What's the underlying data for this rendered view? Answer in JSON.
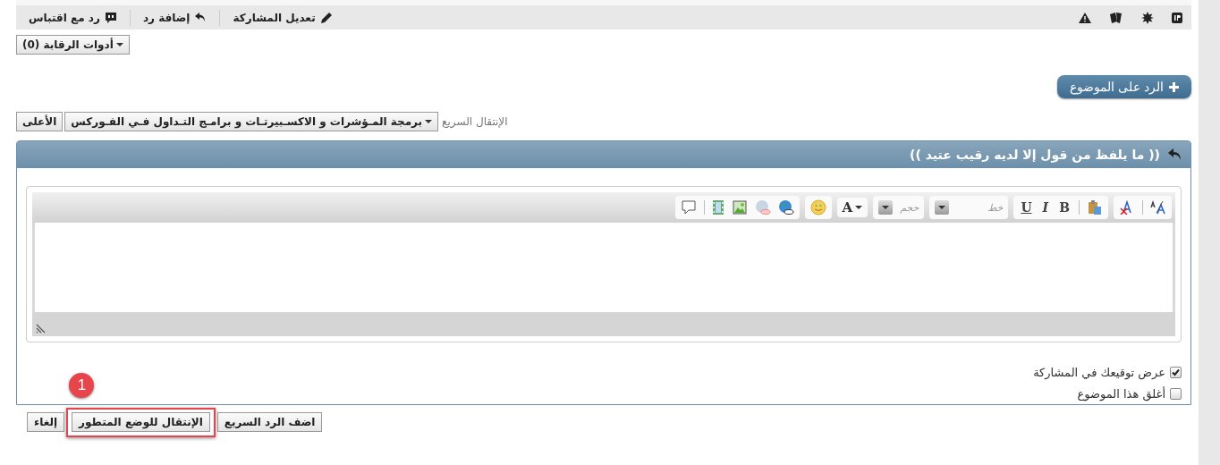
{
  "post_toolbar": {
    "links": [
      {
        "label": "تعديل المشاركة",
        "kind": "edit"
      },
      {
        "label": "إضافة رد",
        "kind": "reply"
      },
      {
        "label": "رد مع اقتباس",
        "kind": "quote"
      }
    ]
  },
  "moderation_button": "أدوات الرقابة (0)",
  "reply_button": "الرد على الموضوع",
  "quick_nav": {
    "label": "الإنتقال السريع",
    "forum": "برمجة المـؤشرات و الاكسـبيرتـات و برامـج التـداول فـي الفـوركس",
    "top_button": "الأعلى"
  },
  "quick_reply": {
    "title": "(( ما يلفظ من قول إلا لديه رقيب عتيد ))",
    "editor": {
      "bold": "B",
      "italic": "I",
      "underline": "U",
      "font_placeholder": "خط",
      "size_placeholder": "حجم",
      "color_label": "A"
    },
    "options": [
      {
        "label": "عرض توقيعك في المشاركة",
        "checked": true
      },
      {
        "label": "أغلق هذا الموضوع",
        "checked": false
      }
    ]
  },
  "buttons": [
    {
      "label": "اضف الرد السريع",
      "highlighted": false
    },
    {
      "label": "الإنتقال للوضع المتطور",
      "highlighted": true
    },
    {
      "label": "إلغاء",
      "highlighted": false
    }
  ],
  "annotation": {
    "number": "1"
  }
}
